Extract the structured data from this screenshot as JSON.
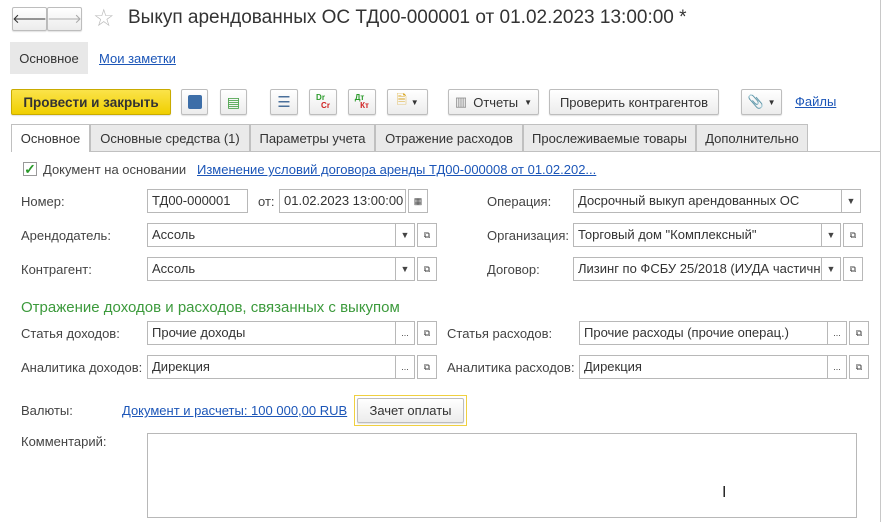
{
  "window": {
    "title": "Выкуп арендованных ОС ТД00-000001 от 01.02.2023 13:00:00 *"
  },
  "nav": {
    "back": "🡐",
    "forward": "🡒"
  },
  "form_tabs": [
    {
      "label": "Основное"
    },
    {
      "label": "Мои заметки"
    }
  ],
  "toolbar": {
    "post_close": "Провести и закрыть",
    "reports": "Отчеты",
    "check_contractors": "Проверить контрагентов",
    "files": "Файлы",
    "dr": "Dr",
    "cr": "Cr",
    "dt": "Дт",
    "kt": "Кт"
  },
  "tabs": [
    {
      "label": "Основное"
    },
    {
      "label": "Основные средства (1)"
    },
    {
      "label": "Параметры учета"
    },
    {
      "label": "Отражение расходов"
    },
    {
      "label": "Прослеживаемые товары"
    },
    {
      "label": "Дополнительно"
    }
  ],
  "basis": {
    "label": "Документ на основании",
    "checked": true,
    "link": "Изменение условий договора аренды ТД00-000008 от 01.02.202..."
  },
  "fields": {
    "number": {
      "label": "Номер:",
      "value": "ТД00-000001"
    },
    "date": {
      "label": "от:",
      "value": "01.02.2023 13:00:00"
    },
    "operation": {
      "label": "Операция:",
      "value": "Досрочный выкуп арендованных ОС"
    },
    "lessor": {
      "label": "Арендодатель:",
      "value": "Ассоль"
    },
    "organization": {
      "label": "Организация:",
      "value": "Торговый дом \"Комплексный\""
    },
    "counterparty": {
      "label": "Контрагент:",
      "value": "Ассоль"
    },
    "contract": {
      "label": "Договор:",
      "value": "Лизинг по ФСБУ 25/2018 (ИУДА частичн"
    }
  },
  "section": {
    "title": "Отражение доходов и расходов, связанных с выкупом",
    "color": "#3c9a3c"
  },
  "income": {
    "item_label": "Статья доходов:",
    "item_value": "Прочие доходы",
    "analytics_label": "Аналитика доходов:",
    "analytics_value": "Дирекция"
  },
  "expense": {
    "item_label": "Статья расходов:",
    "item_value": "Прочие расходы (прочие операц.)",
    "analytics_label": "Аналитика расходов:",
    "analytics_value": "Дирекция"
  },
  "currency": {
    "label": "Валюты:",
    "link": "Документ и расчеты: 100 000,00 RUB",
    "offset_button": "Зачет оплаты"
  },
  "comment": {
    "label": "Комментарий:",
    "value": ""
  },
  "dots": "...",
  "colors": {
    "accent_yellow": "#f5d50a",
    "link": "#1c56b8"
  }
}
